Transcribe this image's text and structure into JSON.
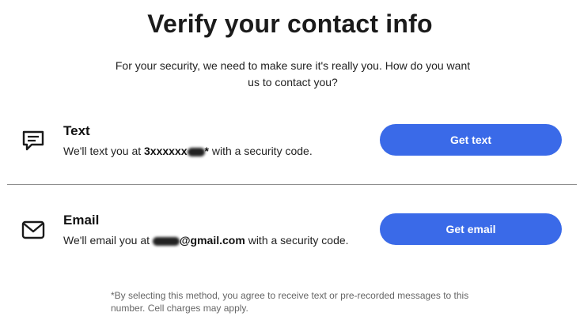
{
  "title": "Verify your contact info",
  "subtitle": "For your security, we need to make sure it's really you. How do you want us to contact you?",
  "options": {
    "text": {
      "icon": "message-icon",
      "heading": "Text",
      "desc_before": "We'll text you at ",
      "masked_value_visible": "3xxxxxx",
      "masked_value_after": "*",
      "desc_after": " with a security code.",
      "button_label": "Get text"
    },
    "email": {
      "icon": "envelope-icon",
      "heading": "Email",
      "desc_before": "We'll email you at ",
      "masked_value_visible": "@gmail.com",
      "desc_after": " with a security code.",
      "button_label": "Get email"
    }
  },
  "disclaimer": "*By selecting this method, you agree to receive text or pre-recorded messages to this number. Cell charges may apply.",
  "colors": {
    "button": "#3a6ae8",
    "divider": "#8f8f8f"
  }
}
